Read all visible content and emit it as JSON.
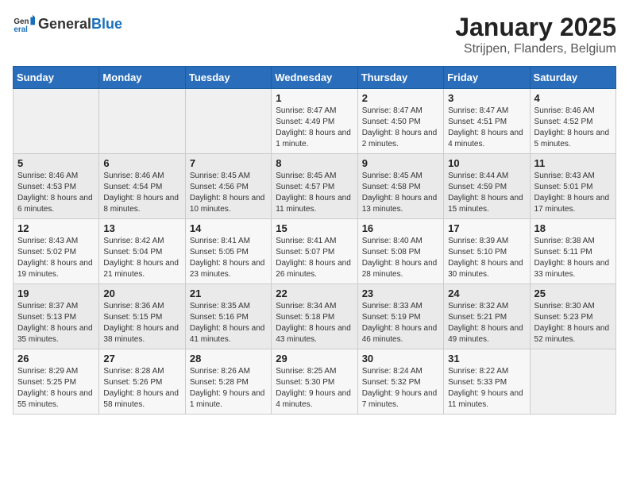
{
  "header": {
    "logo_general": "General",
    "logo_blue": "Blue",
    "title": "January 2025",
    "subtitle": "Strijpen, Flanders, Belgium"
  },
  "weekdays": [
    "Sunday",
    "Monday",
    "Tuesday",
    "Wednesday",
    "Thursday",
    "Friday",
    "Saturday"
  ],
  "weeks": [
    [
      {
        "day": "",
        "empty": true
      },
      {
        "day": "",
        "empty": true
      },
      {
        "day": "",
        "empty": true
      },
      {
        "day": "1",
        "sunrise": "8:47 AM",
        "sunset": "4:49 PM",
        "daylight": "8 hours and 1 minute."
      },
      {
        "day": "2",
        "sunrise": "8:47 AM",
        "sunset": "4:50 PM",
        "daylight": "8 hours and 2 minutes."
      },
      {
        "day": "3",
        "sunrise": "8:47 AM",
        "sunset": "4:51 PM",
        "daylight": "8 hours and 4 minutes."
      },
      {
        "day": "4",
        "sunrise": "8:46 AM",
        "sunset": "4:52 PM",
        "daylight": "8 hours and 5 minutes."
      }
    ],
    [
      {
        "day": "5",
        "sunrise": "8:46 AM",
        "sunset": "4:53 PM",
        "daylight": "8 hours and 6 minutes."
      },
      {
        "day": "6",
        "sunrise": "8:46 AM",
        "sunset": "4:54 PM",
        "daylight": "8 hours and 8 minutes."
      },
      {
        "day": "7",
        "sunrise": "8:45 AM",
        "sunset": "4:56 PM",
        "daylight": "8 hours and 10 minutes."
      },
      {
        "day": "8",
        "sunrise": "8:45 AM",
        "sunset": "4:57 PM",
        "daylight": "8 hours and 11 minutes."
      },
      {
        "day": "9",
        "sunrise": "8:45 AM",
        "sunset": "4:58 PM",
        "daylight": "8 hours and 13 minutes."
      },
      {
        "day": "10",
        "sunrise": "8:44 AM",
        "sunset": "4:59 PM",
        "daylight": "8 hours and 15 minutes."
      },
      {
        "day": "11",
        "sunrise": "8:43 AM",
        "sunset": "5:01 PM",
        "daylight": "8 hours and 17 minutes."
      }
    ],
    [
      {
        "day": "12",
        "sunrise": "8:43 AM",
        "sunset": "5:02 PM",
        "daylight": "8 hours and 19 minutes."
      },
      {
        "day": "13",
        "sunrise": "8:42 AM",
        "sunset": "5:04 PM",
        "daylight": "8 hours and 21 minutes."
      },
      {
        "day": "14",
        "sunrise": "8:41 AM",
        "sunset": "5:05 PM",
        "daylight": "8 hours and 23 minutes."
      },
      {
        "day": "15",
        "sunrise": "8:41 AM",
        "sunset": "5:07 PM",
        "daylight": "8 hours and 26 minutes."
      },
      {
        "day": "16",
        "sunrise": "8:40 AM",
        "sunset": "5:08 PM",
        "daylight": "8 hours and 28 minutes."
      },
      {
        "day": "17",
        "sunrise": "8:39 AM",
        "sunset": "5:10 PM",
        "daylight": "8 hours and 30 minutes."
      },
      {
        "day": "18",
        "sunrise": "8:38 AM",
        "sunset": "5:11 PM",
        "daylight": "8 hours and 33 minutes."
      }
    ],
    [
      {
        "day": "19",
        "sunrise": "8:37 AM",
        "sunset": "5:13 PM",
        "daylight": "8 hours and 35 minutes."
      },
      {
        "day": "20",
        "sunrise": "8:36 AM",
        "sunset": "5:15 PM",
        "daylight": "8 hours and 38 minutes."
      },
      {
        "day": "21",
        "sunrise": "8:35 AM",
        "sunset": "5:16 PM",
        "daylight": "8 hours and 41 minutes."
      },
      {
        "day": "22",
        "sunrise": "8:34 AM",
        "sunset": "5:18 PM",
        "daylight": "8 hours and 43 minutes."
      },
      {
        "day": "23",
        "sunrise": "8:33 AM",
        "sunset": "5:19 PM",
        "daylight": "8 hours and 46 minutes."
      },
      {
        "day": "24",
        "sunrise": "8:32 AM",
        "sunset": "5:21 PM",
        "daylight": "8 hours and 49 minutes."
      },
      {
        "day": "25",
        "sunrise": "8:30 AM",
        "sunset": "5:23 PM",
        "daylight": "8 hours and 52 minutes."
      }
    ],
    [
      {
        "day": "26",
        "sunrise": "8:29 AM",
        "sunset": "5:25 PM",
        "daylight": "8 hours and 55 minutes."
      },
      {
        "day": "27",
        "sunrise": "8:28 AM",
        "sunset": "5:26 PM",
        "daylight": "8 hours and 58 minutes."
      },
      {
        "day": "28",
        "sunrise": "8:26 AM",
        "sunset": "5:28 PM",
        "daylight": "9 hours and 1 minute."
      },
      {
        "day": "29",
        "sunrise": "8:25 AM",
        "sunset": "5:30 PM",
        "daylight": "9 hours and 4 minutes."
      },
      {
        "day": "30",
        "sunrise": "8:24 AM",
        "sunset": "5:32 PM",
        "daylight": "9 hours and 7 minutes."
      },
      {
        "day": "31",
        "sunrise": "8:22 AM",
        "sunset": "5:33 PM",
        "daylight": "9 hours and 11 minutes."
      },
      {
        "day": "",
        "empty": true
      }
    ]
  ]
}
